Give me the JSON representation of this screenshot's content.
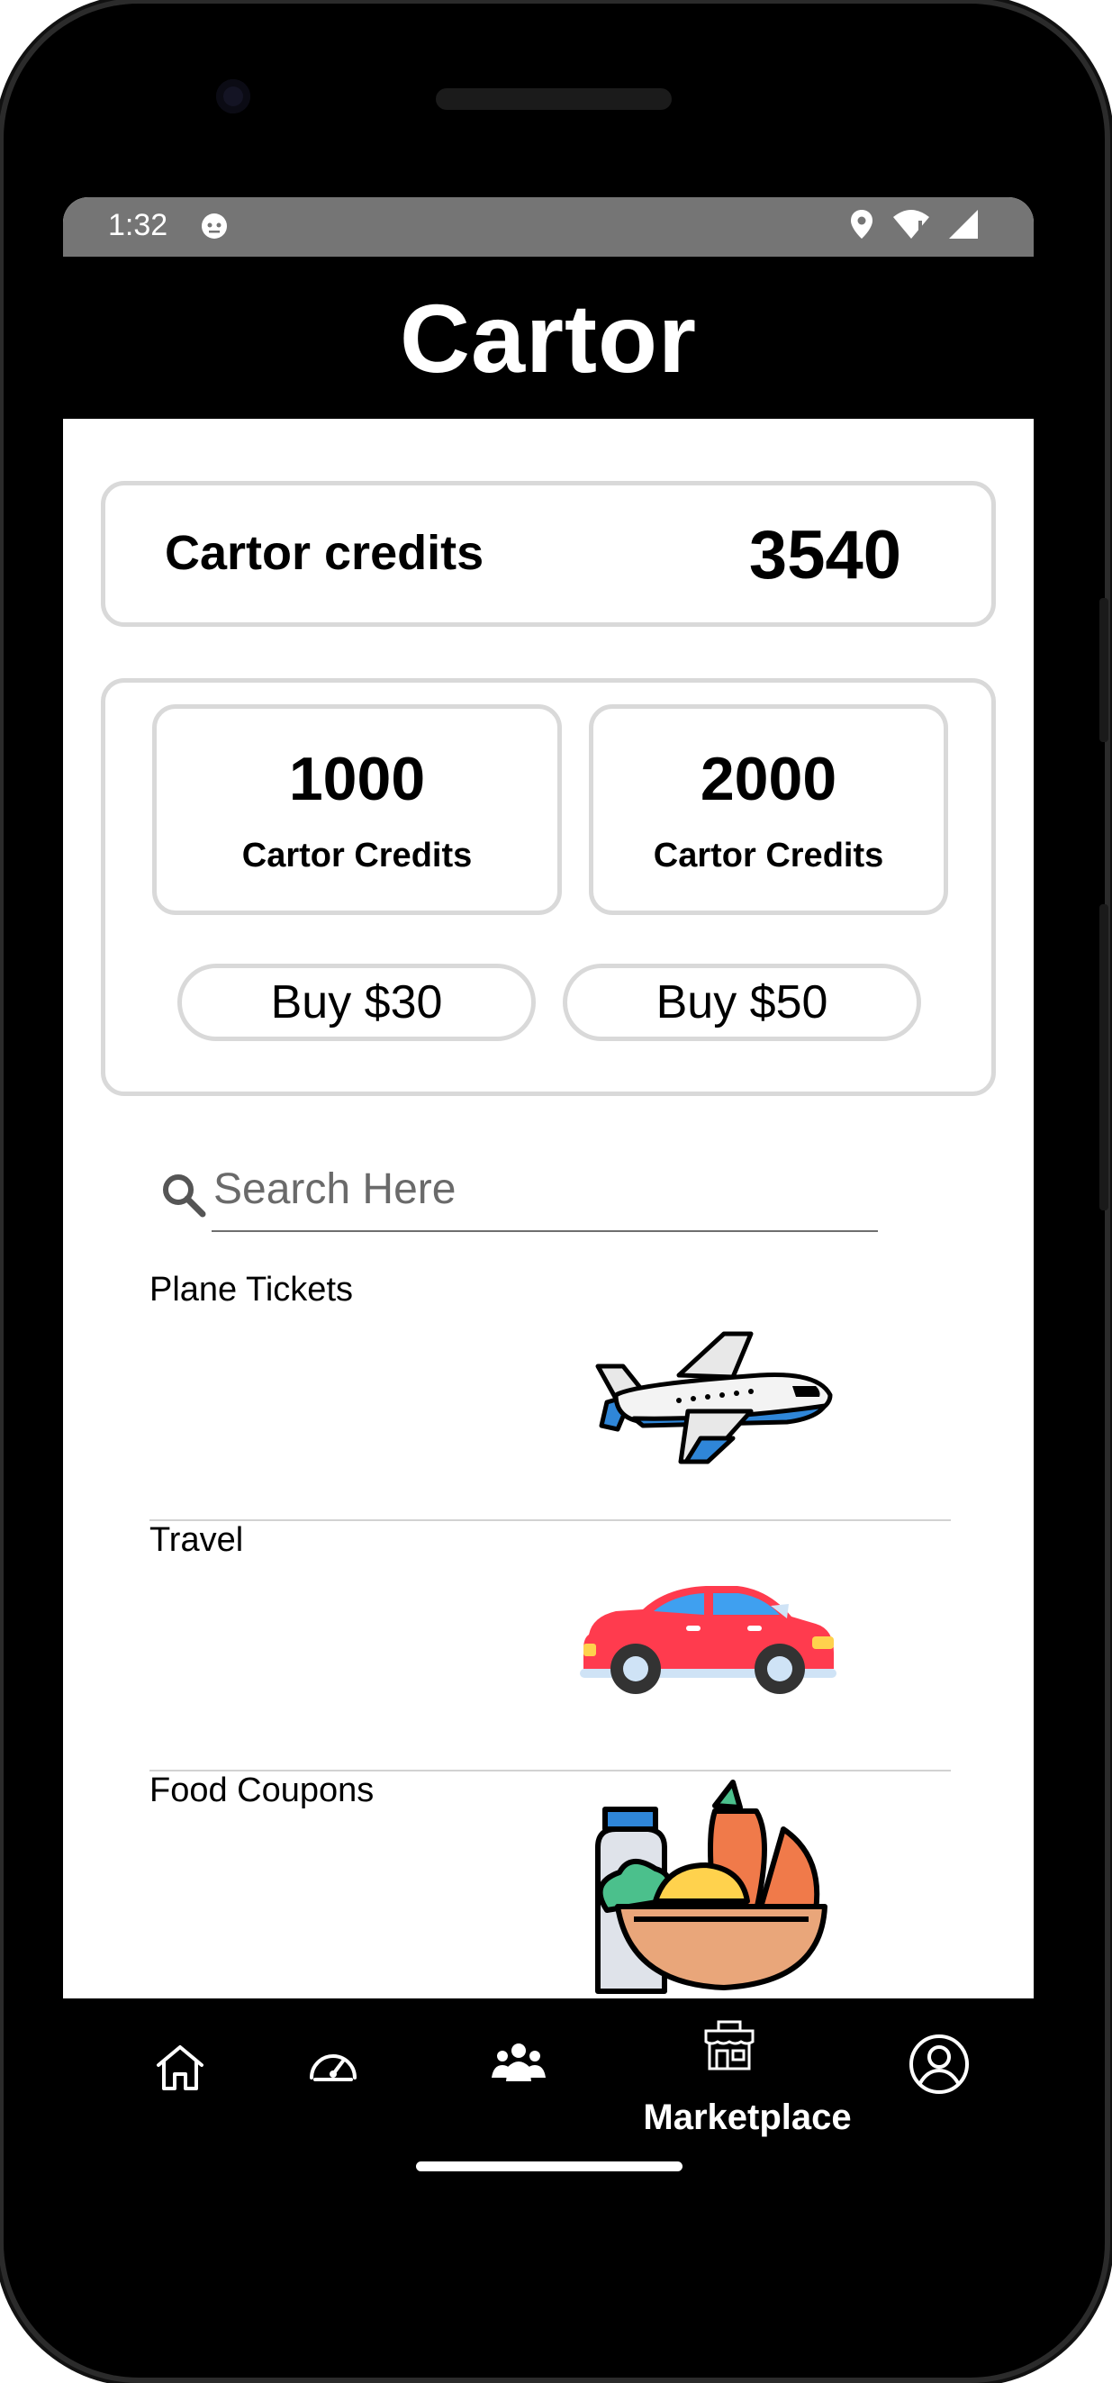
{
  "status_bar": {
    "time": "1:32"
  },
  "app_bar": {
    "title": "Cartor"
  },
  "credits": {
    "label": "Cartor credits",
    "value": "3540"
  },
  "packages": [
    {
      "amount": "1000",
      "unit": "Cartor Credits",
      "buy_label": "Buy $30"
    },
    {
      "amount": "2000",
      "unit": "Cartor Credits",
      "buy_label": "Buy $50"
    }
  ],
  "search": {
    "placeholder": "Search Here",
    "value": ""
  },
  "categories": [
    {
      "title": "Plane Tickets",
      "icon": "airplane-icon"
    },
    {
      "title": "Travel",
      "icon": "car-icon"
    },
    {
      "title": "Food Coupons",
      "icon": "grocery-basket-icon"
    }
  ],
  "bottom_nav": {
    "items": [
      {
        "icon": "home-icon",
        "label": ""
      },
      {
        "icon": "speedometer-icon",
        "label": ""
      },
      {
        "icon": "community-icon",
        "label": ""
      },
      {
        "icon": "store-icon",
        "label": "Marketplace"
      },
      {
        "icon": "profile-icon",
        "label": ""
      }
    ],
    "active": "Marketplace"
  },
  "colors": {
    "app_bar": "#000000",
    "status_bar": "#757575",
    "card_border": "#d9d9d9",
    "airplane_blue": "#2f86d8",
    "car_red": "#ff3b4e"
  }
}
